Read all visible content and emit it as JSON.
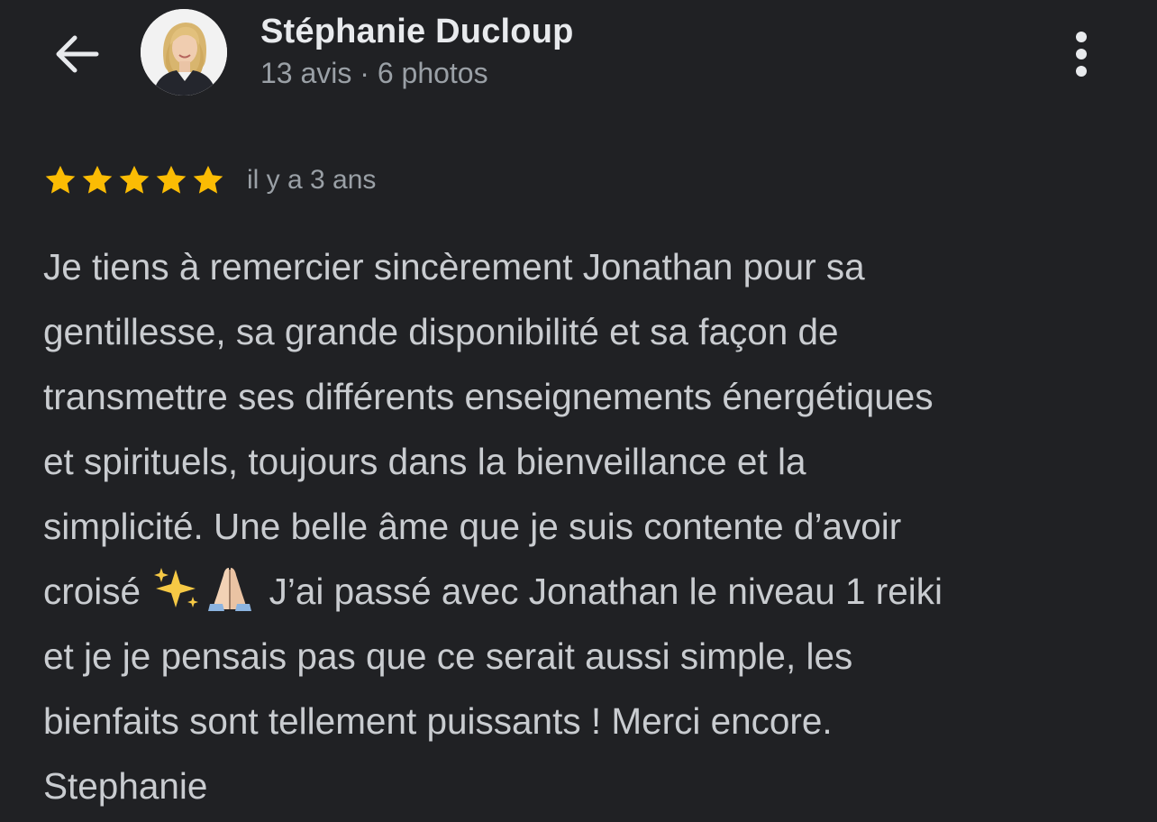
{
  "header": {
    "back_icon": "arrow-left-icon",
    "author_name": "Stéphanie Ducloup",
    "author_meta": "13 avis · 6 photos",
    "more_icon": "more-vertical-icon"
  },
  "review": {
    "rating": 5,
    "rating_max": 5,
    "star_color": "#fbbc04",
    "date": "il y a 3 ans",
    "lines": [
      "Je tiens à remercier sincèrement Jonathan pour sa",
      "gentillesse, sa grande disponibilité et sa façon de",
      "transmettre ses différents enseignements énergétiques",
      "et spirituels, toujours dans la bienveillance et la",
      "simplicité. Une belle âme que je suis contente d’avoir"
    ],
    "line6_start": "croisé",
    "line6_emojis": [
      "sparkles-icon",
      "folded-hands-icon"
    ],
    "line6_end": "J’ai passé avec Jonathan le niveau 1 reiki",
    "lines_after": [
      "et je je pensais pas que ce serait aussi simple, les",
      "bienfaits sont tellement puissants ! Merci encore.",
      "Stephanie"
    ]
  },
  "colors": {
    "background": "#202124",
    "primary_text": "#e8eaed",
    "secondary_text": "#9aa0a6",
    "body_text": "#c9ccd0"
  }
}
